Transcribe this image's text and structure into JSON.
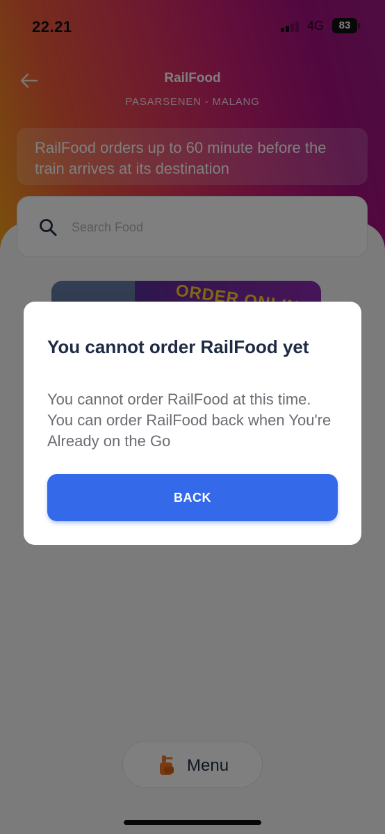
{
  "status_bar": {
    "time": "22.21",
    "network": "4G",
    "battery": "83"
  },
  "header": {
    "title": "RailFood",
    "route": "PASARSENEN - MALANG",
    "info": "RailFood orders up to 60 minute before the train arrives at its destination"
  },
  "search": {
    "placeholder": "Search Food",
    "value": ""
  },
  "promo": {
    "text": "ORDER ONLINE"
  },
  "menu_button": {
    "label": "Menu"
  },
  "dialog": {
    "title": "You cannot order RailFood yet",
    "message": "You cannot order RailFood at this time. You can order RailFood back when You're Already on the Go",
    "button_label": "BACK"
  },
  "colors": {
    "primary": "#3469ea",
    "title_text": "#1f2a44",
    "gradient_start": "#f5a11a",
    "gradient_end": "#9a1b82"
  },
  "icons": [
    "back-arrow-icon",
    "search-icon",
    "food-bag-icon",
    "signal-icon",
    "battery-icon"
  ]
}
